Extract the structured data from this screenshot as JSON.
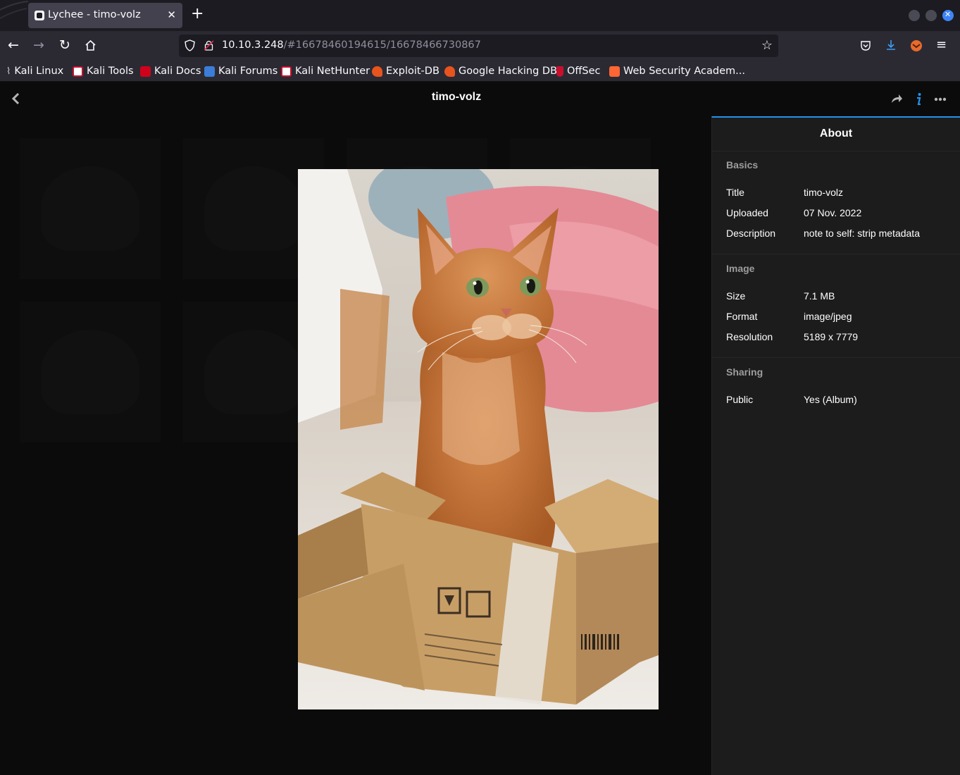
{
  "browser": {
    "tab_title": "Lychee - timo-volz",
    "url_host": "10.10.3.248",
    "url_path": "/#16678460194615/16678466730867",
    "bookmarks": [
      {
        "label": "Kali Linux",
        "color": "#1f1f1f"
      },
      {
        "label": "Kali Tools",
        "color": "#c8102e"
      },
      {
        "label": "Kali Docs",
        "color": "#d0021b"
      },
      {
        "label": "Kali Forums",
        "color": "#3b7dd8"
      },
      {
        "label": "Kali NetHunter",
        "color": "#c8102e"
      },
      {
        "label": "Exploit-DB",
        "color": "#e8541e"
      },
      {
        "label": "Google Hacking DB",
        "color": "#e8541e"
      },
      {
        "label": "OffSec",
        "color": "#c8102e"
      },
      {
        "label": "Web Security Academ...",
        "color": "#ff6633"
      }
    ]
  },
  "app": {
    "page_title": "timo-volz"
  },
  "sidebar": {
    "title": "About",
    "sections": {
      "basics": {
        "heading": "Basics",
        "rows": [
          {
            "key": "Title",
            "value": "timo-volz"
          },
          {
            "key": "Uploaded",
            "value": "07 Nov. 2022"
          },
          {
            "key": "Description",
            "value": "note to self: strip metadata"
          }
        ]
      },
      "image": {
        "heading": "Image",
        "rows": [
          {
            "key": "Size",
            "value": "7.1 MB"
          },
          {
            "key": "Format",
            "value": "image/jpeg"
          },
          {
            "key": "Resolution",
            "value": "5189 x 7779"
          }
        ]
      },
      "sharing": {
        "heading": "Sharing",
        "rows": [
          {
            "key": "Public",
            "value": "Yes (Album)"
          }
        ]
      }
    }
  },
  "colors": {
    "accent": "#2293ec",
    "background": "#0b0b0b",
    "sidebar_bg": "#1c1c1c"
  }
}
